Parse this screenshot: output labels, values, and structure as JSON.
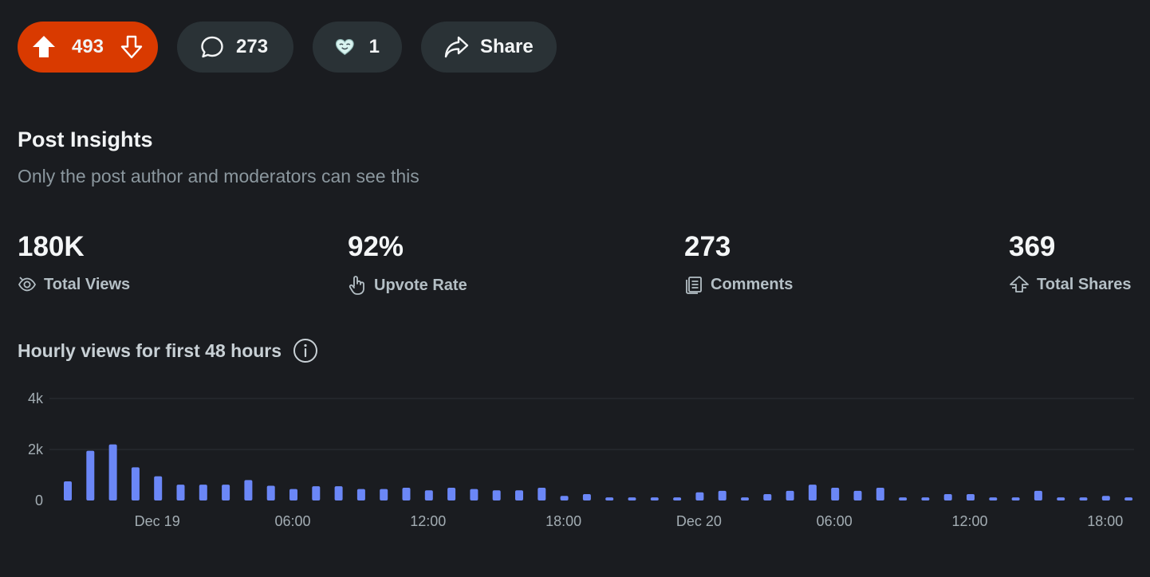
{
  "actions": {
    "upvote_count": "493",
    "comment_count": "273",
    "award_count": "1",
    "share_label": "Share"
  },
  "insights": {
    "title": "Post Insights",
    "subtitle": "Only the post author and moderators can see this",
    "stats": [
      {
        "value": "180K",
        "label": "Total Views",
        "icon": "eye-icon"
      },
      {
        "value": "92%",
        "label": "Upvote Rate",
        "icon": "hand-pointer-icon"
      },
      {
        "value": "273",
        "label": "Comments",
        "icon": "comments-icon"
      },
      {
        "value": "369",
        "label": "Total Shares",
        "icon": "share-arrow-icon"
      }
    ]
  },
  "chart_title": "Hourly views for first 48 hours",
  "colors": {
    "background": "#1a1c20",
    "pill": "#2a3236",
    "vote_accent": "#d93a00",
    "bar": "#6b87f7",
    "grid": "#2c3136"
  },
  "chart_data": {
    "type": "bar",
    "title": "Hourly views for first 48 hours",
    "xlabel": "",
    "ylabel": "",
    "ylim": [
      0,
      4000
    ],
    "yticks": [
      {
        "value": 0,
        "label": "0"
      },
      {
        "value": 2000,
        "label": "2k"
      },
      {
        "value": 4000,
        "label": "4k"
      }
    ],
    "x_tick_labels": [
      {
        "index": 4,
        "label": "Dec 19"
      },
      {
        "index": 10,
        "label": "06:00"
      },
      {
        "index": 16,
        "label": "12:00"
      },
      {
        "index": 22,
        "label": "18:00"
      },
      {
        "index": 28,
        "label": "Dec 20"
      },
      {
        "index": 34,
        "label": "06:00"
      },
      {
        "index": 40,
        "label": "12:00"
      },
      {
        "index": 46,
        "label": "18:00"
      }
    ],
    "grid": true,
    "values": [
      750,
      1950,
      2200,
      1300,
      950,
      620,
      620,
      620,
      800,
      580,
      450,
      560,
      560,
      450,
      450,
      500,
      400,
      500,
      450,
      400,
      400,
      500,
      180,
      250,
      120,
      120,
      120,
      120,
      320,
      380,
      120,
      250,
      380,
      620,
      500,
      380,
      500,
      120,
      120,
      250,
      250,
      120,
      120,
      380,
      120,
      120,
      180,
      120
    ]
  }
}
